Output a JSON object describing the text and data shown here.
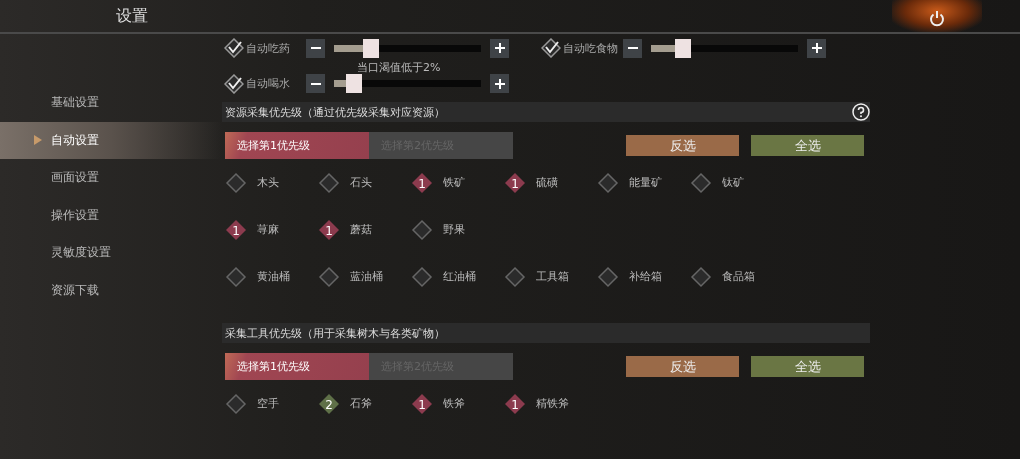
{
  "header": {
    "title": "设置"
  },
  "sidebar": {
    "items": [
      {
        "label": "基础设置",
        "selected": false
      },
      {
        "label": "自动设置",
        "selected": true
      },
      {
        "label": "画面设置",
        "selected": false
      },
      {
        "label": "操作设置",
        "selected": false
      },
      {
        "label": "灵敏度设置",
        "selected": false
      },
      {
        "label": "资源下载",
        "selected": false
      }
    ]
  },
  "auto_rows": [
    {
      "sliders": [
        {
          "label": "自动吃药",
          "checked": true,
          "level": 0.2
        },
        {
          "label": "自动吃食物",
          "checked": true,
          "level": 0.16
        }
      ]
    },
    {
      "hint": "当口渴值低于2%",
      "sliders": [
        {
          "label": "自动喝水",
          "checked": true,
          "level": 0.08
        }
      ]
    }
  ],
  "sections": [
    {
      "title": "资源采集优先级（通过优先级采集对应资源）",
      "help": true,
      "tabs": [
        {
          "label": "选择第1优先级",
          "selected": true
        },
        {
          "label": "选择第2优先级",
          "selected": false
        }
      ],
      "buttons": [
        {
          "label": "反选",
          "kind": "invert"
        },
        {
          "label": "全选",
          "kind": "all"
        }
      ],
      "rows": [
        [
          {
            "label": "木头",
            "checked": false
          },
          {
            "label": "石头",
            "checked": false
          },
          {
            "label": "铁矿",
            "checked": true,
            "priority": "1",
            "color": "#8c3b4e"
          },
          {
            "label": "硫磺",
            "checked": true,
            "priority": "1",
            "color": "#8c3b4e"
          },
          {
            "label": "能量矿",
            "checked": false
          },
          {
            "label": "钛矿",
            "checked": false
          }
        ],
        [
          {
            "label": "荨麻",
            "checked": true,
            "priority": "1",
            "color": "#8c3b4e"
          },
          {
            "label": "蘑菇",
            "checked": true,
            "priority": "1",
            "color": "#8c3b4e"
          },
          {
            "label": "野果",
            "checked": false
          }
        ],
        [
          {
            "label": "黄油桶",
            "checked": false
          },
          {
            "label": "蓝油桶",
            "checked": false
          },
          {
            "label": "红油桶",
            "checked": false
          },
          {
            "label": "工具箱",
            "checked": false
          },
          {
            "label": "补给箱",
            "checked": false
          },
          {
            "label": "食品箱",
            "checked": false
          }
        ]
      ]
    },
    {
      "title": "采集工具优先级（用于采集树木与各类矿物）",
      "help": false,
      "tabs": [
        {
          "label": "选择第1优先级",
          "selected": true
        },
        {
          "label": "选择第2优先级",
          "selected": false
        }
      ],
      "buttons": [
        {
          "label": "反选",
          "kind": "invert"
        },
        {
          "label": "全选",
          "kind": "all"
        }
      ],
      "rows": [
        [
          {
            "label": "空手",
            "checked": false
          },
          {
            "label": "石斧",
            "checked": true,
            "priority": "2",
            "color": "#5f7048"
          },
          {
            "label": "铁斧",
            "checked": true,
            "priority": "1",
            "color": "#8c3b4e"
          },
          {
            "label": "精铁斧",
            "checked": true,
            "priority": "1",
            "color": "#8c3b4e"
          }
        ]
      ]
    }
  ]
}
